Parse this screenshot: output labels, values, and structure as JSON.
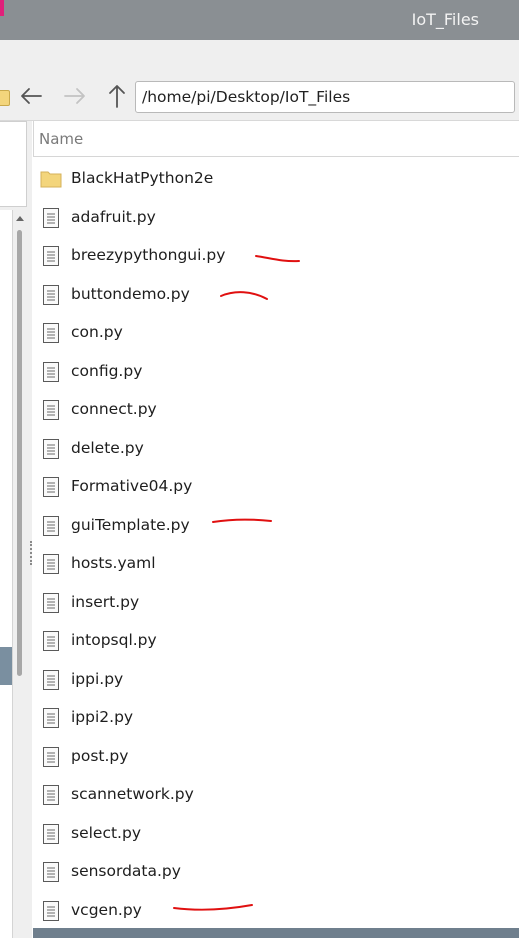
{
  "window": {
    "title": "IoT_Files"
  },
  "toolbar": {
    "back_icon": "arrow-left-icon",
    "forward_icon": "arrow-right-icon",
    "up_icon": "arrow-up-icon",
    "path": "/home/pi/Desktop/IoT_Files"
  },
  "file_list": {
    "column_header": "Name",
    "items": [
      {
        "name": "BlackHatPython2e",
        "icon": "folder-icon"
      },
      {
        "name": "adafruit.py",
        "icon": "text-file-icon"
      },
      {
        "name": "breezypythongui.py",
        "icon": "text-file-icon"
      },
      {
        "name": "buttondemo.py",
        "icon": "text-file-icon"
      },
      {
        "name": "con.py",
        "icon": "text-file-icon"
      },
      {
        "name": "config.py",
        "icon": "text-file-icon"
      },
      {
        "name": "connect.py",
        "icon": "text-file-icon"
      },
      {
        "name": "delete.py",
        "icon": "text-file-icon"
      },
      {
        "name": "Formative04.py",
        "icon": "text-file-icon"
      },
      {
        "name": "guiTemplate.py",
        "icon": "text-file-icon"
      },
      {
        "name": "hosts.yaml",
        "icon": "text-file-icon"
      },
      {
        "name": "insert.py",
        "icon": "text-file-icon"
      },
      {
        "name": "intopsql.py",
        "icon": "text-file-icon"
      },
      {
        "name": "ippi.py",
        "icon": "text-file-icon"
      },
      {
        "name": "ippi2.py",
        "icon": "text-file-icon"
      },
      {
        "name": "post.py",
        "icon": "text-file-icon"
      },
      {
        "name": "scannetwork.py",
        "icon": "text-file-icon"
      },
      {
        "name": "select.py",
        "icon": "text-file-icon"
      },
      {
        "name": "sensordata.py",
        "icon": "text-file-icon"
      },
      {
        "name": "vcgen.py",
        "icon": "text-file-icon"
      }
    ]
  },
  "colors": {
    "titlebar": "#8a8f93",
    "annotation": "#e01010",
    "folder": "#f3d57c"
  }
}
